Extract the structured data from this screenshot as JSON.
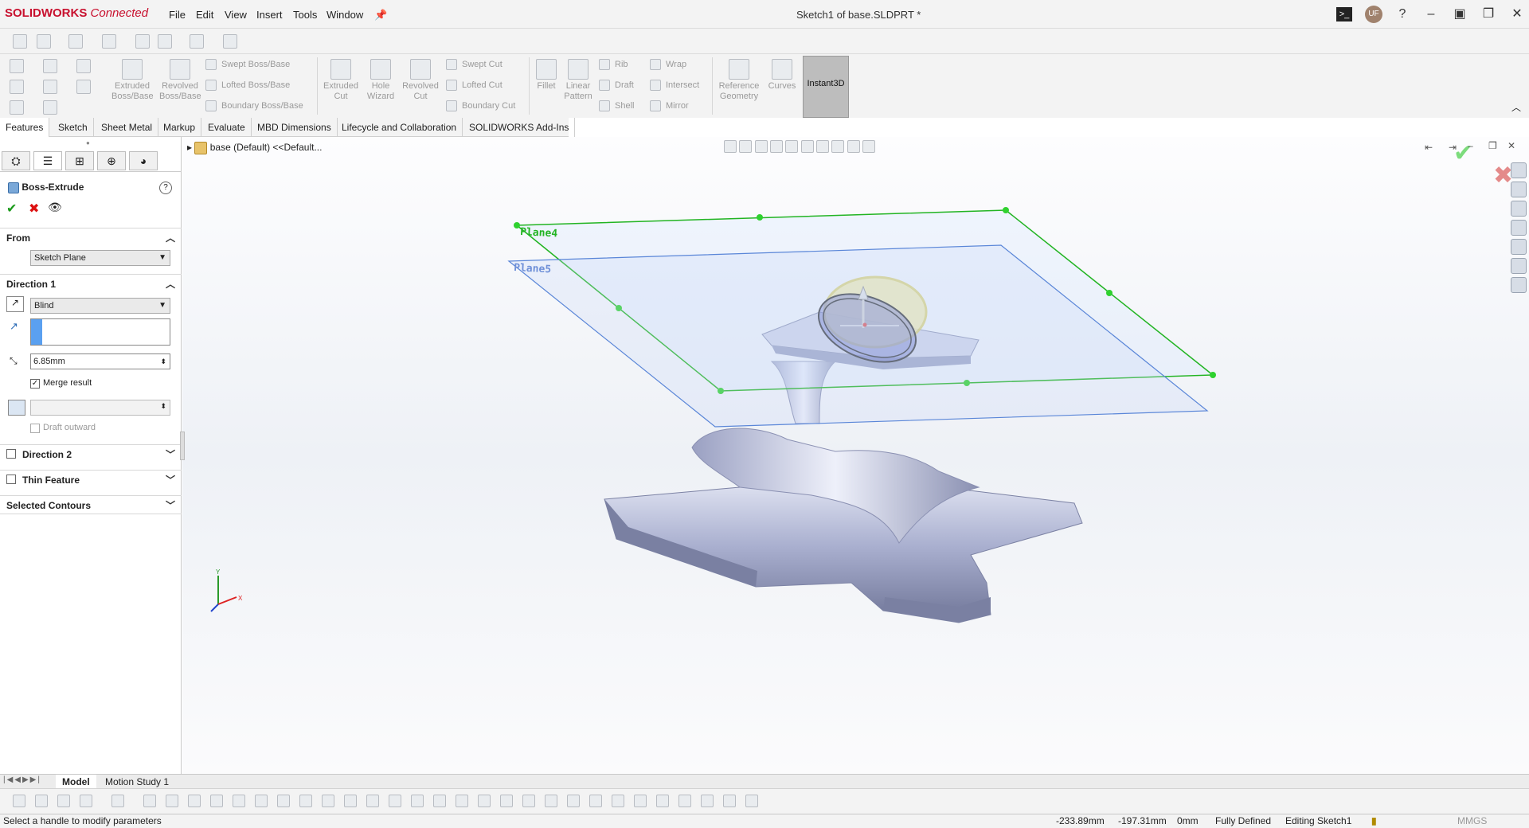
{
  "app": {
    "logo_brand": "SOLIDWORKS",
    "logo_suffix": "Connected",
    "doc_title": "Sketch1 of base.SLDPRT *",
    "avatar_initials": "UF"
  },
  "menu": [
    "File",
    "Edit",
    "View",
    "Insert",
    "Tools",
    "Window"
  ],
  "command_manager": {
    "big_buttons": [
      {
        "label": "Extruded\nBoss/Base"
      },
      {
        "label": "Revolved\nBoss/Base"
      },
      {
        "label": "Extruded\nCut"
      },
      {
        "label": "Hole\nWizard"
      },
      {
        "label": "Revolved\nCut"
      },
      {
        "label": "Fillet"
      },
      {
        "label": "Linear\nPattern"
      },
      {
        "label": "Reference\nGeometry"
      },
      {
        "label": "Curves"
      }
    ],
    "small_buttons": [
      "Swept Boss/Base",
      "Lofted Boss/Base",
      "Boundary Boss/Base",
      "Swept Cut",
      "Lofted Cut",
      "Boundary Cut",
      "Rib",
      "Draft",
      "Shell",
      "Wrap",
      "Intersect",
      "Mirror"
    ],
    "instant3d": "Instant3D"
  },
  "tabs": [
    "Features",
    "Sketch",
    "Sheet Metal",
    "Markup",
    "Evaluate",
    "MBD Dimensions",
    "Lifecycle and Collaboration",
    "SOLIDWORKS Add-Ins"
  ],
  "property_manager": {
    "title": "Boss-Extrude",
    "from_label": "From",
    "from_value": "Sketch Plane",
    "direction1_label": "Direction 1",
    "end_condition": "Blind",
    "depth": "6.85mm",
    "merge_result": "Merge result",
    "draft_outward": "Draft outward",
    "direction2_label": "Direction 2",
    "thin_feature_label": "Thin Feature",
    "selected_contours_label": "Selected Contours"
  },
  "tree": {
    "root": "base (Default) <<Default..."
  },
  "viewport": {
    "plane_a": "Plane4",
    "plane_b": "Plane5",
    "triad_y": "Y",
    "triad_x": "X"
  },
  "bottom_tabs": [
    "Model",
    "Motion Study 1"
  ],
  "status": {
    "message": "Select a handle to modify parameters",
    "x": "-233.89mm",
    "y": "-197.31mm",
    "z": "0mm",
    "defined": "Fully Defined",
    "editing": "Editing Sketch1",
    "units": "MMGS"
  }
}
